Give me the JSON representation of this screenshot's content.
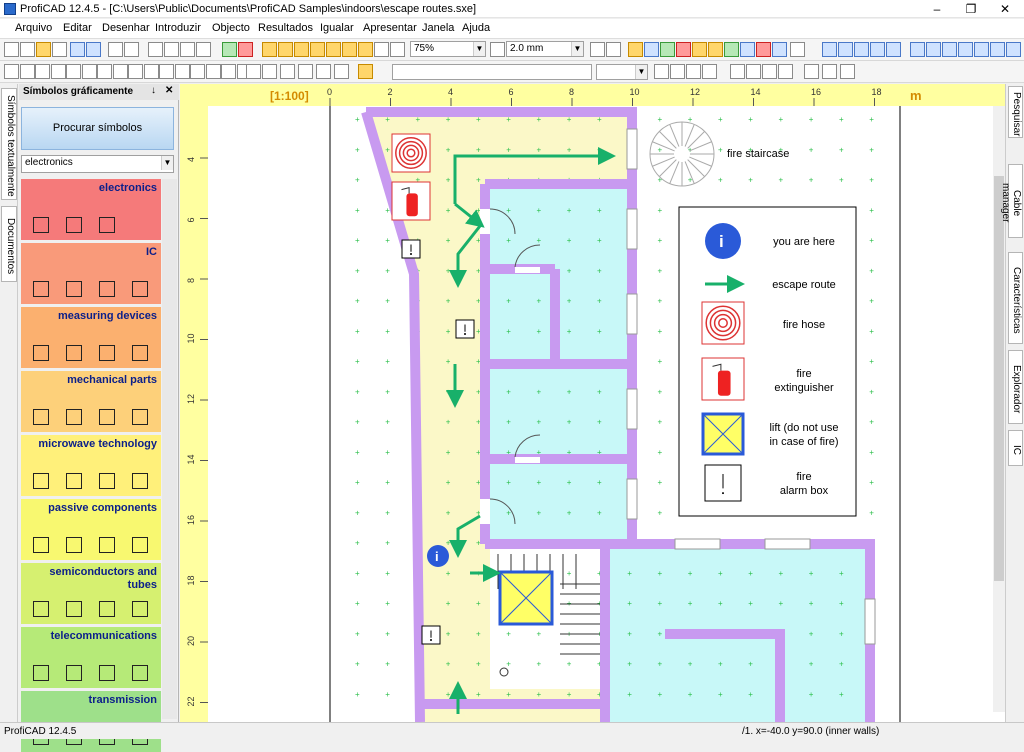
{
  "window": {
    "title": "ProfiCAD 12.4.5 - [C:\\Users\\Public\\Documents\\ProfiCAD Samples\\indoors\\escape routes.sxe]"
  },
  "menu": [
    "Arquivo",
    "Editar",
    "Desenhar",
    "Introduzir",
    "Objecto",
    "Resultados",
    "Igualar",
    "Apresentar",
    "Janela",
    "Ajuda"
  ],
  "toolbar": {
    "zoom": "75%",
    "line_width": "2.0 mm"
  },
  "left_tabs": [
    "Símbolos textualmente",
    "Documentos"
  ],
  "right_tabs": [
    "Pesquisar",
    "Cable manager",
    "Características",
    "Explorador",
    "IC"
  ],
  "panel": {
    "title": "Símbolos gráficamente",
    "pin": "↓",
    "close": "✕",
    "search_button": "Procurar símbolos",
    "library": "electronics",
    "categories": [
      {
        "name": "electronics",
        "color": "#f57a7a"
      },
      {
        "name": "IC",
        "color": "#f99a7a"
      },
      {
        "name": "measuring devices",
        "color": "#fbb06f"
      },
      {
        "name": "mechanical parts",
        "color": "#fdd07a"
      },
      {
        "name": "microwave technology",
        "color": "#fff07a"
      },
      {
        "name": "passive components",
        "color": "#f8f870"
      },
      {
        "name": "semiconductors and tubes",
        "color": "#d6f070"
      },
      {
        "name": "telecommunications",
        "color": "#b6ea78"
      },
      {
        "name": "transmission",
        "color": "#9ee08a"
      }
    ]
  },
  "ruler": {
    "scale": "[1:100]",
    "unit": "m",
    "h_ticks": [
      "0",
      "2",
      "4",
      "6",
      "8",
      "10",
      "12",
      "14",
      "16",
      "18"
    ],
    "v_ticks": [
      "4",
      "6",
      "8",
      "10",
      "12",
      "14",
      "16",
      "18",
      "20",
      "22"
    ]
  },
  "drawing": {
    "labels": {
      "fire_staircase": "fire staircase",
      "info_badge": "i"
    },
    "legend": [
      {
        "icon": "info-icon",
        "text": "you are here"
      },
      {
        "icon": "escape-arrow-icon",
        "text": "escape route"
      },
      {
        "icon": "fire-hose-icon",
        "text": "fire hose"
      },
      {
        "icon": "fire-extinguisher-icon",
        "text": "fire\nextinguisher"
      },
      {
        "icon": "lift-icon",
        "text": "lift (do not use\nin case of fire)"
      },
      {
        "icon": "fire-alarm-icon",
        "text": "fire\nalarm box"
      }
    ]
  },
  "status": {
    "left": "ProfiCAD 12.4.5",
    "right": "/1.  x=-40.0  y=90.0 (inner walls)"
  },
  "colors": {
    "wall": "#c89af0",
    "corridor": "#fbf8c8",
    "room": "#c8f8f8",
    "arrow": "#18b06a",
    "grid_dot": "#2bbf4a",
    "info_blue": "#2a5ad8"
  }
}
